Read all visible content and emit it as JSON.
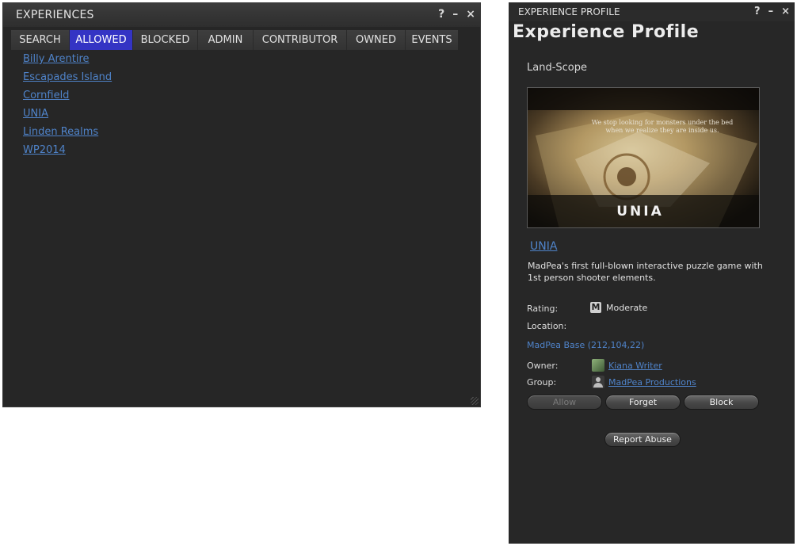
{
  "experiences": {
    "title": "EXPERIENCES",
    "controls": {
      "help": "?",
      "minimize": "–",
      "close": "×"
    },
    "tabs": [
      {
        "label": "SEARCH"
      },
      {
        "label": "ALLOWED",
        "active": true
      },
      {
        "label": "BLOCKED"
      },
      {
        "label": "ADMIN"
      },
      {
        "label": "CONTRIBUTOR"
      },
      {
        "label": "OWNED"
      },
      {
        "label": "EVENTS"
      }
    ],
    "items": [
      "Billy Arentire",
      "Escapades Island",
      "Cornfield",
      "UNIA",
      "Linden Realms",
      "WP2014"
    ]
  },
  "profile": {
    "window_title": "EXPERIENCE PROFILE",
    "controls": {
      "help": "?",
      "minimize": "–",
      "close": "×"
    },
    "heading": "Experience Profile",
    "subtitle": "Land-Scope",
    "image_caption_line1": "We stop looking for monsters under the bed",
    "image_caption_line2": "when we realize they are inside us.",
    "image_logo": "UNIA",
    "name": "UNIA",
    "description": "MadPea's first full-blown interactive puzzle game with 1st person shooter elements.",
    "rating_label": "Rating:",
    "rating_badge": "M",
    "rating_value": "Moderate",
    "location_label": "Location:",
    "location_value": "MadPea Base (212,104,22)",
    "owner_label": "Owner:",
    "owner_value": "Kiana Writer",
    "group_label": "Group:",
    "group_value": "MadPea Productions",
    "buttons": {
      "allow": "Allow",
      "forget": "Forget",
      "block": "Block",
      "report": "Report Abuse"
    }
  },
  "colors": {
    "link": "#4f83c9",
    "active_tab": "#3434c4",
    "panel": "#262626"
  }
}
